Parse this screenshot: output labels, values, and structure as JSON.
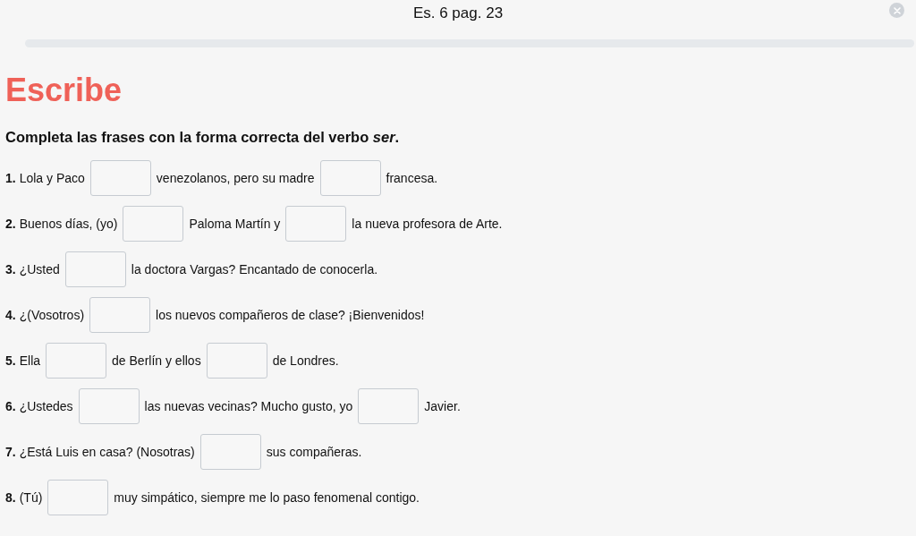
{
  "header": {
    "title": "Es. 6 pag. 23"
  },
  "heading": "Escribe",
  "instruction": "Completa las frases con la forma correcta del verbo *ser*.",
  "items": [
    {
      "number": "1.",
      "parts": [
        {
          "kind": "text",
          "text": "Lola y Paco"
        },
        {
          "kind": "blank"
        },
        {
          "kind": "text",
          "text": "venezolanos, pero su madre"
        },
        {
          "kind": "blank"
        },
        {
          "kind": "text",
          "text": "francesa."
        }
      ]
    },
    {
      "number": "2.",
      "parts": [
        {
          "kind": "text",
          "text": "Buenos días, (yo)"
        },
        {
          "kind": "blank"
        },
        {
          "kind": "text",
          "text": "Paloma Martín y"
        },
        {
          "kind": "blank"
        },
        {
          "kind": "text",
          "text": "la nueva profesora de Arte."
        }
      ]
    },
    {
      "number": "3.",
      "parts": [
        {
          "kind": "text",
          "text": "¿Usted"
        },
        {
          "kind": "blank"
        },
        {
          "kind": "text",
          "text": "la doctora Vargas? Encantado de conocerla."
        }
      ]
    },
    {
      "number": "4.",
      "parts": [
        {
          "kind": "text",
          "text": "¿(Vosotros)"
        },
        {
          "kind": "blank"
        },
        {
          "kind": "text",
          "text": "los nuevos compañeros de clase? ¡Bienvenidos!"
        }
      ]
    },
    {
      "number": "5.",
      "parts": [
        {
          "kind": "text",
          "text": "Ella"
        },
        {
          "kind": "blank"
        },
        {
          "kind": "text",
          "text": "de Berlín y ellos"
        },
        {
          "kind": "blank"
        },
        {
          "kind": "text",
          "text": "de Londres."
        }
      ]
    },
    {
      "number": "6.",
      "parts": [
        {
          "kind": "text",
          "text": "¿Ustedes"
        },
        {
          "kind": "blank"
        },
        {
          "kind": "text",
          "text": "las nuevas vecinas? Mucho gusto, yo"
        },
        {
          "kind": "blank"
        },
        {
          "kind": "text",
          "text": "Javier."
        }
      ]
    },
    {
      "number": "7.",
      "parts": [
        {
          "kind": "text",
          "text": "¿Está Luis en casa? (Nosotras)"
        },
        {
          "kind": "blank"
        },
        {
          "kind": "text",
          "text": "sus compañeras."
        }
      ]
    },
    {
      "number": "8.",
      "parts": [
        {
          "kind": "text",
          "text": "(Tú)"
        },
        {
          "kind": "blank"
        },
        {
          "kind": "text",
          "text": "muy simpático, siempre me lo paso fenomenal contigo."
        }
      ]
    }
  ]
}
